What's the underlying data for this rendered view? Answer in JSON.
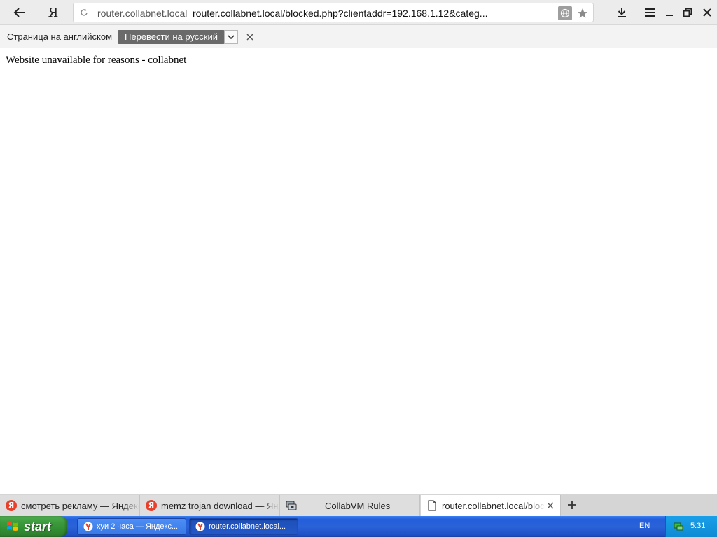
{
  "browser": {
    "host": "router.collabnet.local",
    "url": "router.collabnet.local/blocked.php?clientaddr=192.168.1.12&categ...",
    "ya_label": "Я"
  },
  "translate_bar": {
    "label": "Страница на английском",
    "translate_button": "Перевести на русский"
  },
  "page": {
    "message": "Website unavailable for reasons - collabnet"
  },
  "tabs": [
    {
      "title": "смотреть рекламу — Яндекс",
      "icon": "yandex-icon",
      "active": false
    },
    {
      "title": "memz trojan download — Яндекс",
      "icon": "yandex-icon",
      "active": false
    },
    {
      "title": "CollabVM Rules",
      "icon": "collabvm-icon",
      "active": false
    },
    {
      "title": "router.collabnet.local/blocked",
      "icon": "page-icon",
      "active": true
    }
  ],
  "taskbar": {
    "start_label": "start",
    "tasks": [
      {
        "title": "хуи 2 часа — Яндекс...",
        "icon": "yandex-browser-icon",
        "active": false
      },
      {
        "title": "router.collabnet.local...",
        "icon": "yandex-browser-icon",
        "active": true
      }
    ],
    "language": "EN",
    "clock": "5:31"
  },
  "colors": {
    "taskbar_blue": "#245edb",
    "start_green": "#3c9b3c",
    "yandex_red": "#e8402b",
    "tray_blue": "#1aa0e8"
  }
}
